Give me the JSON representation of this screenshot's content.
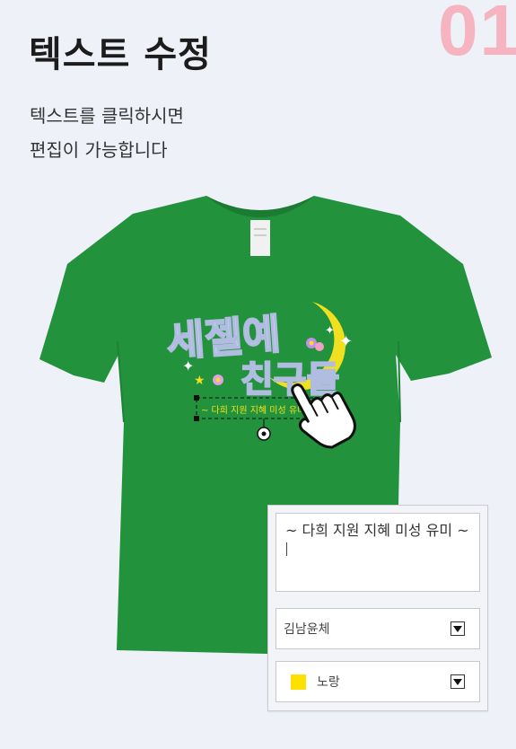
{
  "step_number": "01",
  "title": "텍스트 수정",
  "description": [
    "텍스트를 클릭하시면",
    "편집이 가능합니다"
  ],
  "design": {
    "title_line1": "세젤예",
    "title_line2": "친구들",
    "subtitle": "~ 다희 지원 지혜 미성 유미 ~"
  },
  "editor": {
    "text_value": "~ 다희 지원 지혜 미성 유미 ~",
    "font_select": {
      "selected": "김남윤체"
    },
    "color_select": {
      "selected": "노랑",
      "swatch": "#ffe000"
    }
  },
  "colors": {
    "shirt": "#23923d",
    "accent_pink": "#f5b4c0",
    "moon": "#f0e020"
  },
  "icons": [
    "hand-cursor-icon",
    "close-icon",
    "rotate-icon",
    "dropdown-arrow-icon"
  ]
}
